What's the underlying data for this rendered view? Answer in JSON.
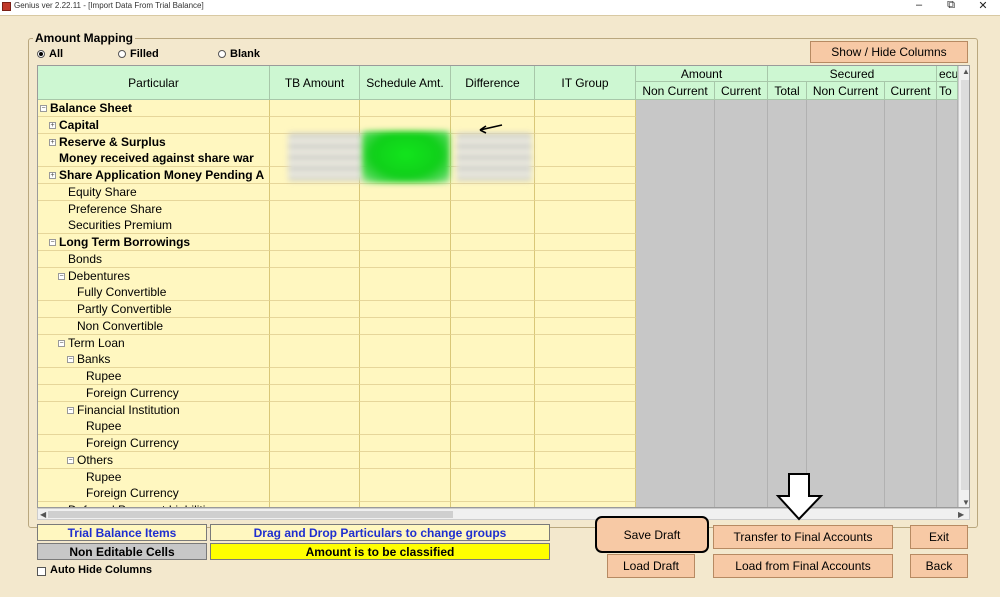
{
  "titlebar": {
    "title": "Genius ver 2.22.11 - [Import Data From Trial Balance]",
    "min": "–",
    "max": "⧉",
    "close": "✕"
  },
  "group": {
    "title": "Amount Mapping"
  },
  "filters": {
    "all": "All",
    "filled": "Filled",
    "blank": "Blank",
    "selected": "All"
  },
  "buttons": {
    "show_hide": "Show / Hide Columns",
    "save_draft": "Save Draft",
    "transfer": "Transfer to Final Accounts",
    "exit": "Exit",
    "load_draft": "Load Draft",
    "load_final": "Load from Final Accounts",
    "back": "Back"
  },
  "grid": {
    "headers": {
      "particular": "Particular",
      "tb_amount": "TB Amount",
      "schedule_amt": "Schedule Amt.",
      "difference": "Difference",
      "it_group": "IT Group",
      "amount": "Amount",
      "secured": "Secured",
      "unsecured_partial": "ecu",
      "non_current": "Non Current",
      "current": "Current",
      "total": "Total",
      "total_partial": "To"
    },
    "rows": [
      {
        "label": "Balance Sheet",
        "bold": true,
        "indent": 0,
        "expander": "−"
      },
      {
        "label": "Capital",
        "bold": true,
        "indent": 1,
        "expander": "+"
      },
      {
        "label": "Reserve & Surplus",
        "bold": true,
        "indent": 1,
        "expander": "+"
      },
      {
        "label": "Money received against share war",
        "bold": true,
        "indent": 1,
        "expander": ""
      },
      {
        "label": "Share Application Money Pending A",
        "bold": true,
        "indent": 1,
        "expander": "+"
      },
      {
        "label": "Equity Share",
        "bold": false,
        "indent": 2,
        "expander": ""
      },
      {
        "label": "Preference Share",
        "bold": false,
        "indent": 2,
        "expander": ""
      },
      {
        "label": "Securities Premium",
        "bold": false,
        "indent": 2,
        "expander": ""
      },
      {
        "label": "Long Term Borrowings",
        "bold": true,
        "indent": 1,
        "expander": "−"
      },
      {
        "label": "Bonds",
        "bold": false,
        "indent": 2,
        "expander": ""
      },
      {
        "label": "Debentures",
        "bold": false,
        "indent": 2,
        "expander": "−"
      },
      {
        "label": "Fully Convertible",
        "bold": false,
        "indent": 3,
        "expander": ""
      },
      {
        "label": "Partly Convertible",
        "bold": false,
        "indent": 3,
        "expander": ""
      },
      {
        "label": "Non Convertible",
        "bold": false,
        "indent": 3,
        "expander": ""
      },
      {
        "label": "Term Loan",
        "bold": false,
        "indent": 2,
        "expander": "−"
      },
      {
        "label": "Banks",
        "bold": false,
        "indent": 3,
        "expander": "−"
      },
      {
        "label": "Rupee",
        "bold": false,
        "indent": 4,
        "expander": ""
      },
      {
        "label": "Foreign Currency",
        "bold": false,
        "indent": 4,
        "expander": ""
      },
      {
        "label": "Financial Institution",
        "bold": false,
        "indent": 3,
        "expander": "−"
      },
      {
        "label": "Rupee",
        "bold": false,
        "indent": 4,
        "expander": ""
      },
      {
        "label": "Foreign Currency",
        "bold": false,
        "indent": 4,
        "expander": ""
      },
      {
        "label": "Others",
        "bold": false,
        "indent": 3,
        "expander": "−"
      },
      {
        "label": "Rupee",
        "bold": false,
        "indent": 4,
        "expander": ""
      },
      {
        "label": "Foreign Currency",
        "bold": false,
        "indent": 4,
        "expander": ""
      },
      {
        "label": "Deferred Payment Liabilities",
        "bold": false,
        "indent": 2,
        "expander": ""
      }
    ]
  },
  "legend": {
    "trial_balance": "Trial Balance Items",
    "drag_drop": "Drag and Drop Particulars to change groups",
    "non_editable": "Non Editable Cells",
    "to_classify": "Amount is to be classified",
    "auto_hide": "Auto Hide Columns"
  },
  "colors": {
    "window_bg": "#f3e8cd",
    "header_bg": "#cdf7d2",
    "cell_bg": "#fff7c0",
    "button_bg": "#f7c9a5",
    "noneditable_bg": "#c7c7c7",
    "classify_bg": "#ffff00",
    "link_blue": "#1f2fcf"
  }
}
